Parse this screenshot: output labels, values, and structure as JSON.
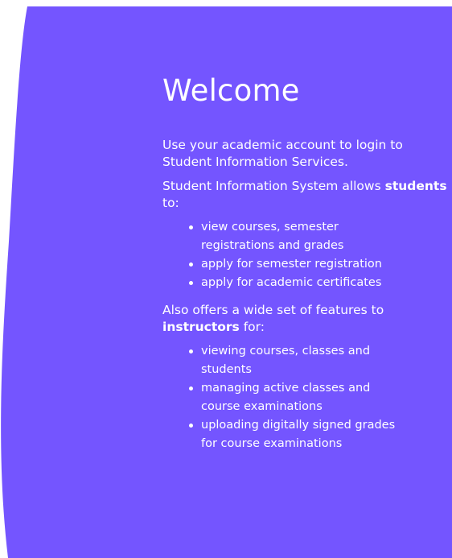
{
  "colors": {
    "panel": "#7455ff",
    "text": "#ffffff",
    "background": "#ffffff"
  },
  "welcome": {
    "title": "Welcome",
    "intro": "Use your academic account to login to Student Information Services.",
    "students_prefix": "Student Information System allows ",
    "students_bold": "students",
    "students_suffix": " to:",
    "students_items": [
      "view courses, semester registrations and grades",
      "apply for semester registration",
      "apply for academic certificates"
    ],
    "instructors_prefix": "Also offers a wide set of features to ",
    "instructors_bold": "instructors",
    "instructors_suffix": " for:",
    "instructors_items": [
      "viewing courses, classes and students",
      "managing active classes and course examinations",
      "uploading digitally signed grades for course examinations"
    ]
  }
}
